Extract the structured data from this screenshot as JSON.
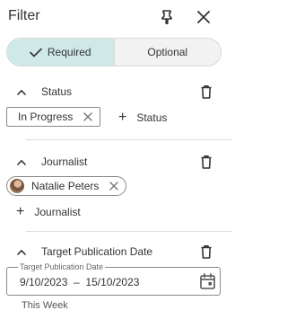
{
  "header": {
    "title": "Filter",
    "pin_icon": "pin-icon",
    "close_icon": "close-icon"
  },
  "toggle": {
    "options": [
      {
        "label": "Required",
        "active": true
      },
      {
        "label": "Optional",
        "active": false
      }
    ],
    "check_icon": "check-icon"
  },
  "sections": {
    "status": {
      "title": "Status",
      "chips": [
        {
          "label": "In Progress"
        }
      ],
      "add_label": "Status"
    },
    "journalist": {
      "title": "Journalist",
      "chips": [
        {
          "label": "Natalie Peters"
        }
      ],
      "add_label": "Journalist"
    },
    "target_date": {
      "title": "Target Publication Date",
      "field_label": "Target Publication Date",
      "range": "9/10/2023  –  15/10/2023",
      "preset": "This Week"
    }
  },
  "colors": {
    "accent_bg": "#cfe9e8",
    "text": "#333333",
    "border": "#8a8a8a"
  }
}
